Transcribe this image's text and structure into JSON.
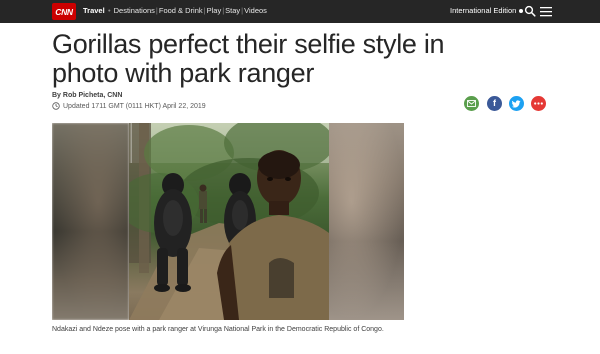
{
  "nav": {
    "logo_text": "CNN",
    "section": "Travel",
    "links": [
      "Destinations",
      "Food & Drink",
      "Play",
      "Stay",
      "Videos"
    ],
    "edition": "International Edition",
    "search_icon": "search-icon",
    "menu_icon": "hamburger-menu-icon"
  },
  "article": {
    "headline": "Gorillas perfect their selfie style in photo with park ranger",
    "byline": "By Rob Picheta, CNN",
    "updated": "Updated 1711 GMT (0111 HKT) April 22, 2019",
    "caption": "Ndakazi and Ndeze pose with a park ranger at Virunga National Park in the Democratic Republic of Congo."
  },
  "share": {
    "email_icon": "email-icon",
    "facebook_icon": "facebook-icon",
    "twitter_icon": "twitter-icon",
    "more_icon": "more-icon"
  },
  "colors": {
    "nav_bg": "#262626",
    "logo_red": "#cc0000",
    "email": "#5a9e4c",
    "facebook": "#3b5998",
    "twitter": "#1da1f2",
    "more": "#e53935"
  }
}
